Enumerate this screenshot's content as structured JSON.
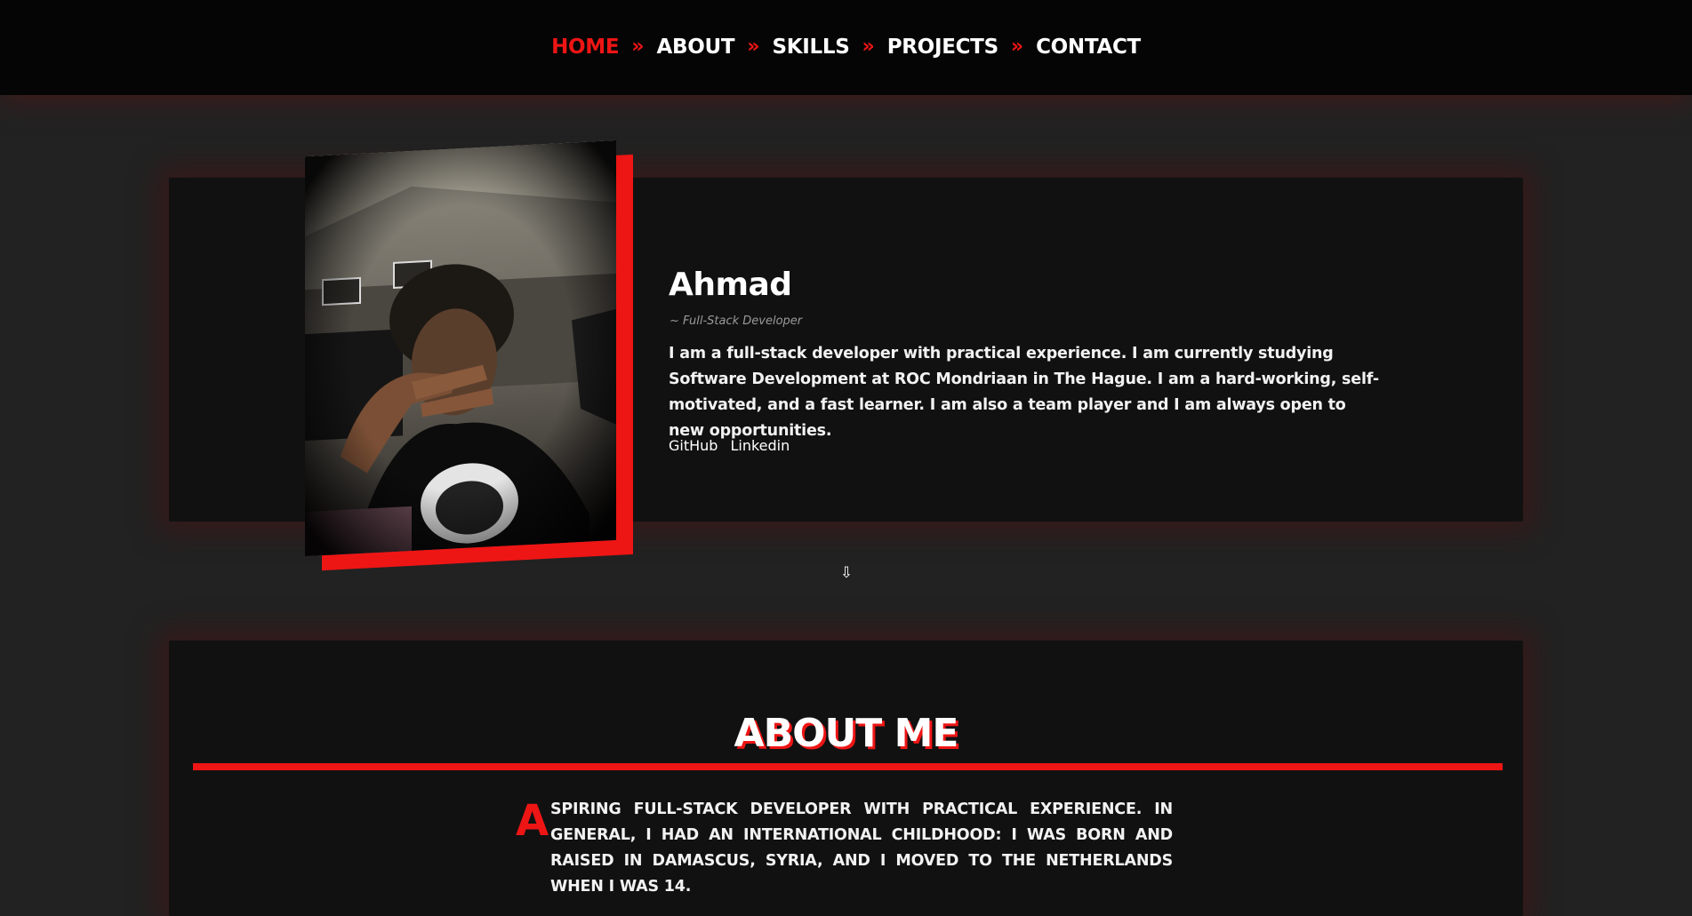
{
  "nav": {
    "items": [
      {
        "label": "HOME",
        "active": true
      },
      {
        "label": "ABOUT",
        "active": false
      },
      {
        "label": "SKILLS",
        "active": false
      },
      {
        "label": "PROJECTS",
        "active": false
      },
      {
        "label": "CONTACT",
        "active": false
      }
    ],
    "separator": "»"
  },
  "hero": {
    "name": "Ahmad",
    "role": "~ Full-Stack Developer",
    "bio": "I am a full-stack developer with practical experience. I am currently studying Software Development at ROC Mondriaan in The Hague. I am a hard-working, self-motivated, and a fast learner. I am also a team player and I am always open to new opportunities.",
    "links": [
      {
        "label": "GitHub"
      },
      {
        "label": "Linkedin"
      }
    ]
  },
  "scroll_icon": "⇩",
  "about": {
    "title": "ABOUT ME",
    "dropcap": "A",
    "text": "spiring full-stack developer with practical experience. In general, I had an international childhood: I was born and raised in Damascus, Syria, and I moved to the Netherlands when I was 14."
  },
  "colors": {
    "accent": "#ee1515",
    "background": "#222222",
    "card": "#111111",
    "nav": "#050505"
  },
  "icons": {
    "scroll": "arrow-down-icon"
  }
}
